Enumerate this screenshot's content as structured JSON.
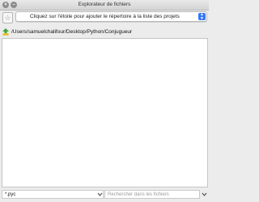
{
  "window": {
    "title": "Explorateur de fichiers",
    "close_glyph": "×",
    "minimize_glyph": "–"
  },
  "toolbar": {
    "star_icon": "star-icon",
    "project_select": {
      "selected": "Cliquez sur l'étoile pour ajouter le répertoire à la liste des projets"
    }
  },
  "path_bar": {
    "icon": "folder-up-icon",
    "path": "/Users/samuelchalifour/Desktop/Python/Conjugueur"
  },
  "file_tree": {
    "items": []
  },
  "footer": {
    "filter_value": "*.pyc",
    "search_placeholder": "Rechercher dans les fichiers"
  },
  "colors": {
    "accent": "#3478f6",
    "path_icon_green": "#3fa53a",
    "path_icon_yellow": "#e5c23a"
  }
}
